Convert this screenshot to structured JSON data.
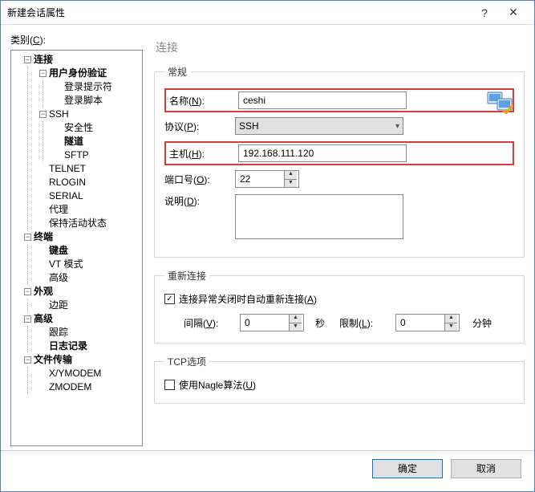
{
  "window": {
    "title": "新建会话属性",
    "help": "?",
    "close": "✕"
  },
  "category": {
    "label_prefix": "类别(",
    "label_key": "C",
    "label_suffix": "):"
  },
  "tree": {
    "t0": "连接",
    "t1": "用户身份验证",
    "t1a": "登录提示符",
    "t1b": "登录脚本",
    "t2": "SSH",
    "t2a": "安全性",
    "t2b": "隧道",
    "t2c": "SFTP",
    "t3": "TELNET",
    "t4": "RLOGIN",
    "t5": "SERIAL",
    "t6": "代理",
    "t7": "保持活动状态",
    "t8": "终端",
    "t8a": "键盘",
    "t8b": "VT 模式",
    "t8c": "高级",
    "t9": "外观",
    "t9a": "边距",
    "t10": "高级",
    "t10a": "跟踪",
    "t10b": "日志记录",
    "t11": "文件传输",
    "t11a": "X/YMODEM",
    "t11b": "ZMODEM"
  },
  "page": {
    "title": "连接"
  },
  "general": {
    "legend": "常规",
    "name_label_pre": "名称(",
    "name_label_key": "N",
    "name_label_post": "):",
    "name_value": "ceshi",
    "proto_label_pre": "协议(",
    "proto_label_key": "P",
    "proto_label_post": "):",
    "proto_value": "SSH",
    "host_label_pre": "主机(",
    "host_label_key": "H",
    "host_label_post": "):",
    "host_value": "192.168.111.120",
    "port_label_pre": "端口号(",
    "port_label_key": "O",
    "port_label_post": "):",
    "port_value": "22",
    "desc_label_pre": "说明(",
    "desc_label_key": "D",
    "desc_label_post": "):",
    "desc_value": ""
  },
  "reconnect": {
    "legend": "重新连接",
    "check_mark": "✓",
    "check_label_pre": "连接异常关闭时自动重新连接(",
    "check_label_key": "A",
    "check_label_post": ")",
    "interval_pre": "间隔(",
    "interval_key": "V",
    "interval_post": "):",
    "interval_value": "0",
    "seconds": "秒",
    "limit_pre": "限制(",
    "limit_key": "L",
    "limit_post": "):",
    "limit_value": "0",
    "minutes": "分钟"
  },
  "tcp": {
    "legend": "TCP选项",
    "nagle_pre": "使用Nagle算法(",
    "nagle_key": "U",
    "nagle_post": ")"
  },
  "footer": {
    "ok": "确定",
    "cancel": "取消"
  }
}
